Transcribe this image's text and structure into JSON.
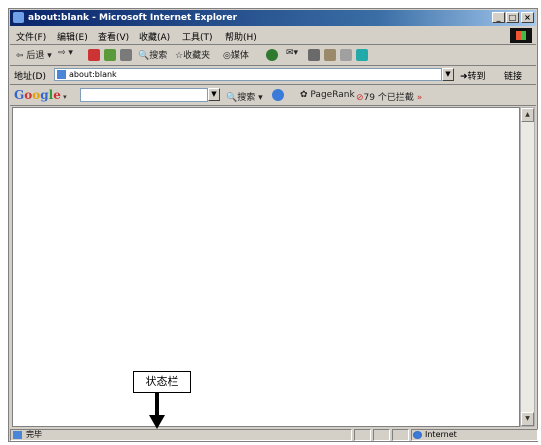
{
  "window": {
    "title": "about:blank - Microsoft Internet Explorer"
  },
  "menu": [
    "文件(F)",
    "编辑(E)",
    "查看(V)",
    "收藏(A)",
    "工具(T)",
    "帮助(H)"
  ],
  "toolbar": {
    "back": "后退",
    "search": "搜索",
    "favorites": "收藏夹",
    "media": "媒体"
  },
  "address": {
    "label": "地址(D)",
    "value": "about:blank",
    "go": "转到",
    "links": "链接"
  },
  "google": {
    "logo": "Google",
    "search_button": "搜索",
    "pagerank": "PageRank",
    "blocked": "79 个已拦截"
  },
  "status": {
    "text": "完毕",
    "zone": "Internet"
  },
  "annotation": {
    "label": "状态栏"
  },
  "colors": {
    "title_bar": "#0a246a",
    "chrome": "#d4d0c8"
  }
}
